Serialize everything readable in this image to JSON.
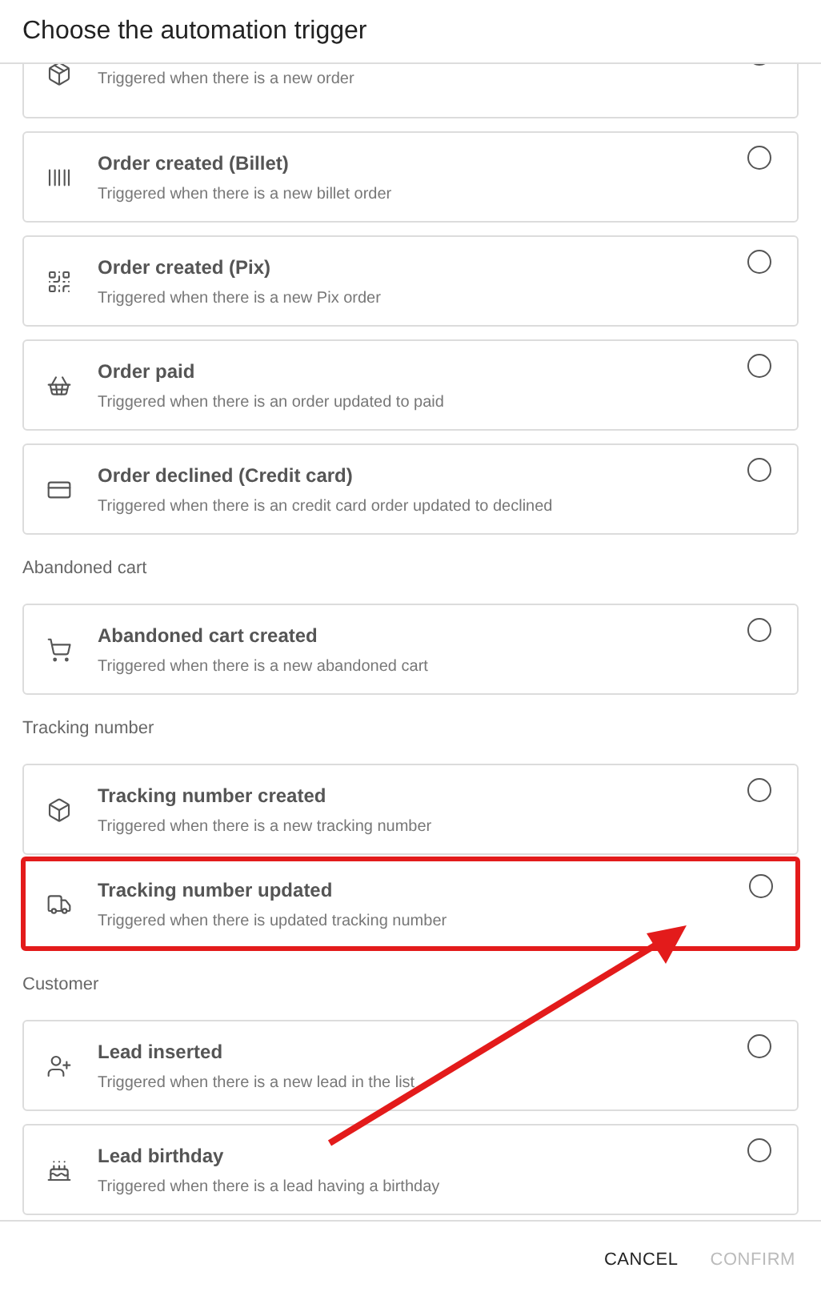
{
  "dialog": {
    "title": "Choose the automation trigger"
  },
  "groups": [
    {
      "items": [
        {
          "description": "Triggered when there is a new order",
          "highlighted": false
        },
        {
          "title": "Order created (Billet)",
          "description": "Triggered when there is a new billet order",
          "selected": false,
          "highlighted": false
        },
        {
          "title": "Order created (Pix)",
          "description": "Triggered when there is a new Pix order",
          "selected": false,
          "highlighted": false
        },
        {
          "title": "Order paid",
          "description": "Triggered when there is an order updated to paid",
          "selected": false,
          "highlighted": false
        },
        {
          "title": "Order declined (Credit card)",
          "description": "Triggered when there is an credit card order updated to declined",
          "selected": false,
          "highlighted": false
        }
      ]
    },
    {
      "label": "Abandoned cart",
      "items": [
        {
          "title": "Abandoned cart created",
          "description": "Triggered when there is a new abandoned cart",
          "selected": false,
          "highlighted": false
        }
      ]
    },
    {
      "label": "Tracking number",
      "items": [
        {
          "title": "Tracking number created",
          "description": "Triggered when there is a new tracking number",
          "selected": false,
          "highlighted": false
        },
        {
          "title": "Tracking number updated",
          "description": "Triggered when there is updated tracking number",
          "selected": false,
          "highlighted": true
        }
      ]
    },
    {
      "label": "Customer",
      "items": [
        {
          "title": "Lead inserted",
          "description": "Triggered when there is a new lead in the list",
          "selected": false,
          "highlighted": false
        },
        {
          "title": "Lead birthday",
          "description": "Triggered when there is a lead having a birthday",
          "selected": false,
          "highlighted": false
        }
      ]
    }
  ],
  "buttons": [
    {
      "label": "CANCEL",
      "disabled": false
    },
    {
      "label": "CONFIRM",
      "disabled": true
    }
  ]
}
